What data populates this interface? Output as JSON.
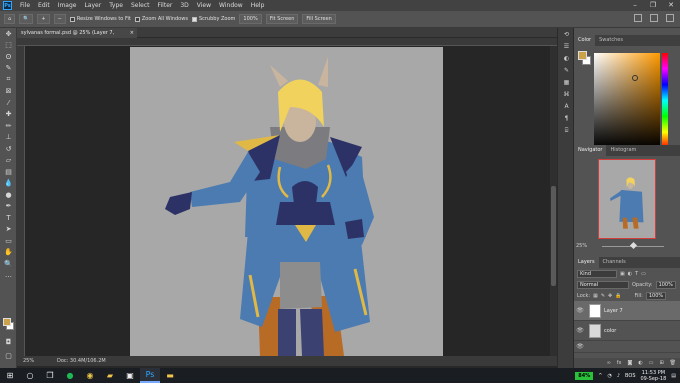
{
  "menubar": {
    "app_logo": "Ps",
    "items": [
      "File",
      "Edit",
      "Image",
      "Layer",
      "Type",
      "Select",
      "Filter",
      "3D",
      "View",
      "Window",
      "Help"
    ]
  },
  "options_bar": {
    "resize_windows": "Resize Windows to Fit",
    "zoom_all": "Zoom All Windows",
    "scrubby_zoom": "Scrubby Zoom",
    "zoom_value": "100%",
    "fit_screen": "Fit Screen",
    "fill_screen": "Fill Screen"
  },
  "document": {
    "tab_title": "sylvanas formal.psd @ 25% (Layer 7, RGB/8#)",
    "tab_close": "×",
    "zoom_status": "25%",
    "doc_status": "Doc: 30.4M/106.2M"
  },
  "panels": {
    "color_tab": "Color",
    "swatches_tab": "Swatches",
    "navigator_tab": "Navigator",
    "histogram_tab": "Histogram",
    "navigator_zoom": "25%",
    "layers_tab": "Layers",
    "channels_tab": "Channels",
    "kind_label": "Kind",
    "blend_mode": "Normal",
    "opacity_label": "Opacity:",
    "opacity_value": "100%",
    "lock_label": "Lock:",
    "fill_label": "Fill:",
    "fill_value": "100%",
    "layers": [
      {
        "name": "Layer 7",
        "selected": true
      },
      {
        "name": "color",
        "selected": false
      }
    ]
  },
  "colors": {
    "foreground": "#c9a24a",
    "background": "#ffffff",
    "canvas": "#a8a8a8"
  },
  "taskbar": {
    "battery": "84%",
    "time": "11:53 PM",
    "date": "09-Sep-18",
    "lang": "BOS"
  }
}
